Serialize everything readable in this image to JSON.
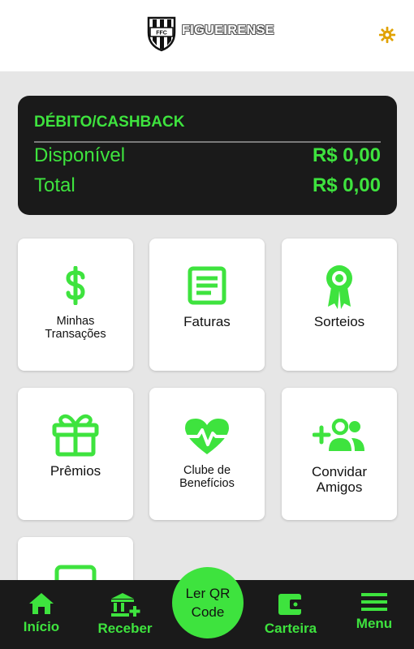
{
  "header": {
    "brand": "FIGUEIRENSE",
    "logo_icon": "club-crest",
    "settings_icon": "gear-icon"
  },
  "balance": {
    "heading": "DÉBITO/CASHBACK",
    "available_label": "Disponível",
    "available_value": "R$ 0,00",
    "total_label": "Total",
    "total_value": "R$ 0,00"
  },
  "tiles": [
    {
      "icon": "dollar-icon",
      "label": "Minhas\nTransações"
    },
    {
      "icon": "invoice-icon",
      "label": "Faturas"
    },
    {
      "icon": "award-icon",
      "label": "Sorteios"
    },
    {
      "icon": "gift-icon",
      "label": "Prêmios"
    },
    {
      "icon": "heartbeat-icon",
      "label": "Clube de\nBenefícios"
    },
    {
      "icon": "add-users-icon",
      "label": "Convidar\nAmigos"
    },
    {
      "icon": "wallet-icon",
      "label": ""
    }
  ],
  "nav": {
    "home": "Início",
    "receive": "Receber",
    "qr": "Ler QR\nCode",
    "wallet": "Carteira",
    "menu": "Menu"
  },
  "colors": {
    "accent": "#3ee33e",
    "dark": "#1a1a1a",
    "background": "#e6e6e6"
  }
}
